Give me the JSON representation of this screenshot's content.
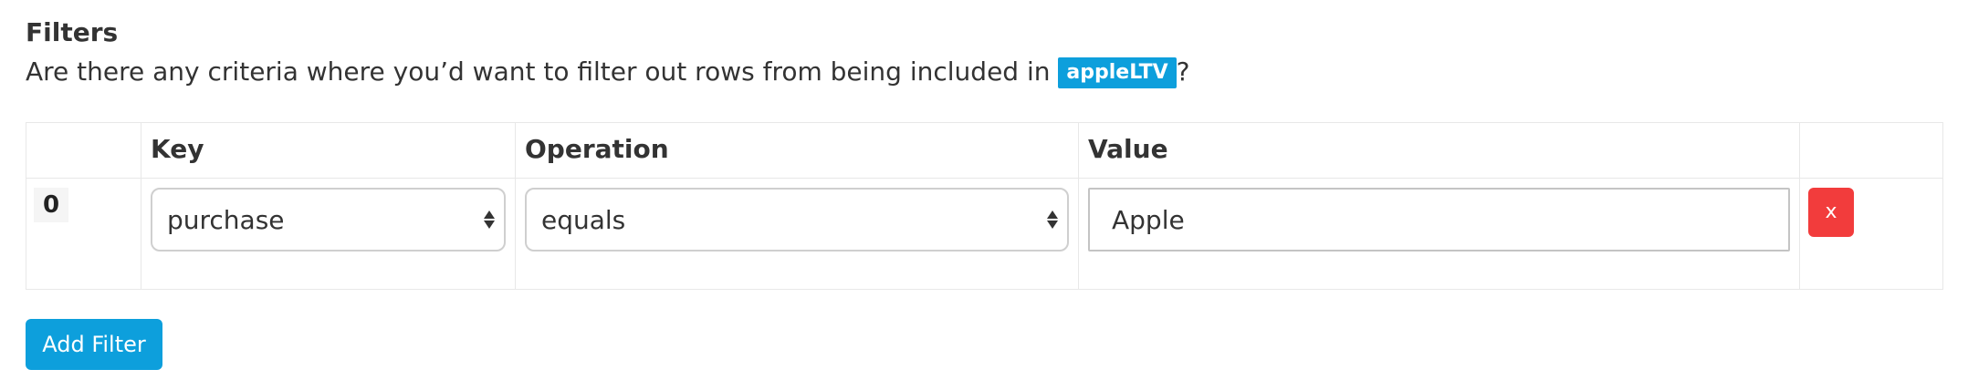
{
  "section": {
    "title": "Filters",
    "description_before": "Are there any criteria where you’d want to filter out rows from being included in ",
    "dataset_badge": "appleLTV",
    "description_after": "?"
  },
  "table": {
    "headers": {
      "index": "",
      "key": "Key",
      "operation": "Operation",
      "value": "Value",
      "actions": ""
    },
    "rows": [
      {
        "index": "0",
        "key": "purchase",
        "operation": "equals",
        "value": "Apple",
        "remove_label": "x"
      }
    ]
  },
  "actions": {
    "add_filter_label": "Add Filter"
  },
  "colors": {
    "accent": "#0d9fdc",
    "danger": "#f23c3c"
  }
}
